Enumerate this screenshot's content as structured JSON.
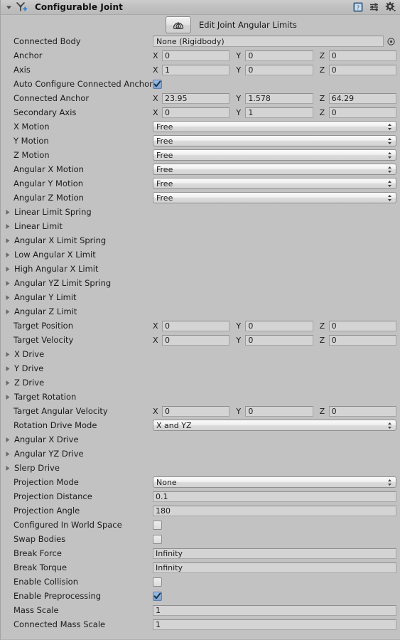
{
  "header": {
    "title": "Configurable Joint",
    "component_icon": "configurable-joint-icon",
    "foldout_state": "expanded",
    "icons": [
      {
        "name": "help-icon",
        "glyph": "book-question"
      },
      {
        "name": "preset-icon",
        "glyph": "sliders"
      },
      {
        "name": "settings-gear-icon",
        "glyph": "gear-dropdown"
      }
    ]
  },
  "edit_button": {
    "icon_name": "joint-angular-limits-icon",
    "label": "Edit Joint Angular Limits"
  },
  "axis_labels": {
    "x": "X",
    "y": "Y",
    "z": "Z"
  },
  "rows": [
    {
      "type": "object",
      "label": "Connected Body",
      "value": "None (Rigidbody)"
    },
    {
      "type": "vector3",
      "label": "Anchor",
      "x": "0",
      "y": "0",
      "z": "0"
    },
    {
      "type": "vector3",
      "label": "Axis",
      "x": "1",
      "y": "0",
      "z": "0"
    },
    {
      "type": "toggle",
      "label": "Auto Configure Connected Anchor",
      "checked": true
    },
    {
      "type": "vector3",
      "label": "Connected Anchor",
      "x": "23.95",
      "y": "1.578",
      "z": "64.29"
    },
    {
      "type": "vector3",
      "label": "Secondary Axis",
      "x": "0",
      "y": "1",
      "z": "0"
    },
    {
      "type": "popup",
      "label": "X Motion",
      "value": "Free"
    },
    {
      "type": "popup",
      "label": "Y Motion",
      "value": "Free"
    },
    {
      "type": "popup",
      "label": "Z Motion",
      "value": "Free"
    },
    {
      "type": "popup",
      "label": "Angular X Motion",
      "value": "Free"
    },
    {
      "type": "popup",
      "label": "Angular Y Motion",
      "value": "Free"
    },
    {
      "type": "popup",
      "label": "Angular Z Motion",
      "value": "Free"
    },
    {
      "type": "foldout",
      "label": "Linear Limit Spring"
    },
    {
      "type": "foldout",
      "label": "Linear Limit"
    },
    {
      "type": "foldout",
      "label": "Angular X Limit Spring"
    },
    {
      "type": "foldout",
      "label": "Low Angular X Limit"
    },
    {
      "type": "foldout",
      "label": "High Angular X Limit"
    },
    {
      "type": "foldout",
      "label": "Angular YZ Limit Spring"
    },
    {
      "type": "foldout",
      "label": "Angular Y Limit"
    },
    {
      "type": "foldout",
      "label": "Angular Z Limit"
    },
    {
      "type": "vector3",
      "label": "Target Position",
      "x": "0",
      "y": "0",
      "z": "0"
    },
    {
      "type": "vector3",
      "label": "Target Velocity",
      "x": "0",
      "y": "0",
      "z": "0"
    },
    {
      "type": "foldout",
      "label": "X Drive"
    },
    {
      "type": "foldout",
      "label": "Y Drive"
    },
    {
      "type": "foldout",
      "label": "Z Drive"
    },
    {
      "type": "foldout",
      "label": "Target Rotation"
    },
    {
      "type": "vector3",
      "label": "Target Angular Velocity",
      "x": "0",
      "y": "0",
      "z": "0"
    },
    {
      "type": "popup",
      "label": "Rotation Drive Mode",
      "value": "X and YZ"
    },
    {
      "type": "foldout",
      "label": "Angular X Drive"
    },
    {
      "type": "foldout",
      "label": "Angular YZ Drive"
    },
    {
      "type": "foldout",
      "label": "Slerp Drive"
    },
    {
      "type": "popup",
      "label": "Projection Mode",
      "value": "None"
    },
    {
      "type": "text",
      "label": "Projection Distance",
      "value": "0.1"
    },
    {
      "type": "text",
      "label": "Projection Angle",
      "value": "180"
    },
    {
      "type": "toggle",
      "label": "Configured In World Space",
      "checked": false
    },
    {
      "type": "toggle",
      "label": "Swap Bodies",
      "checked": false
    },
    {
      "type": "text",
      "label": "Break Force",
      "value": "Infinity"
    },
    {
      "type": "text",
      "label": "Break Torque",
      "value": "Infinity"
    },
    {
      "type": "toggle",
      "label": "Enable Collision",
      "checked": false
    },
    {
      "type": "toggle",
      "label": "Enable Preprocessing",
      "checked": true
    },
    {
      "type": "text",
      "label": "Mass Scale",
      "value": "1"
    },
    {
      "type": "text",
      "label": "Connected Mass Scale",
      "value": "1"
    }
  ],
  "colors": {
    "panel_background": "#c2c2c2",
    "header_background": "#c6c6c6",
    "field_background": "#d4d4d4",
    "checkbox_checked": "#7ea4d0",
    "text": "#1b1b1b"
  }
}
